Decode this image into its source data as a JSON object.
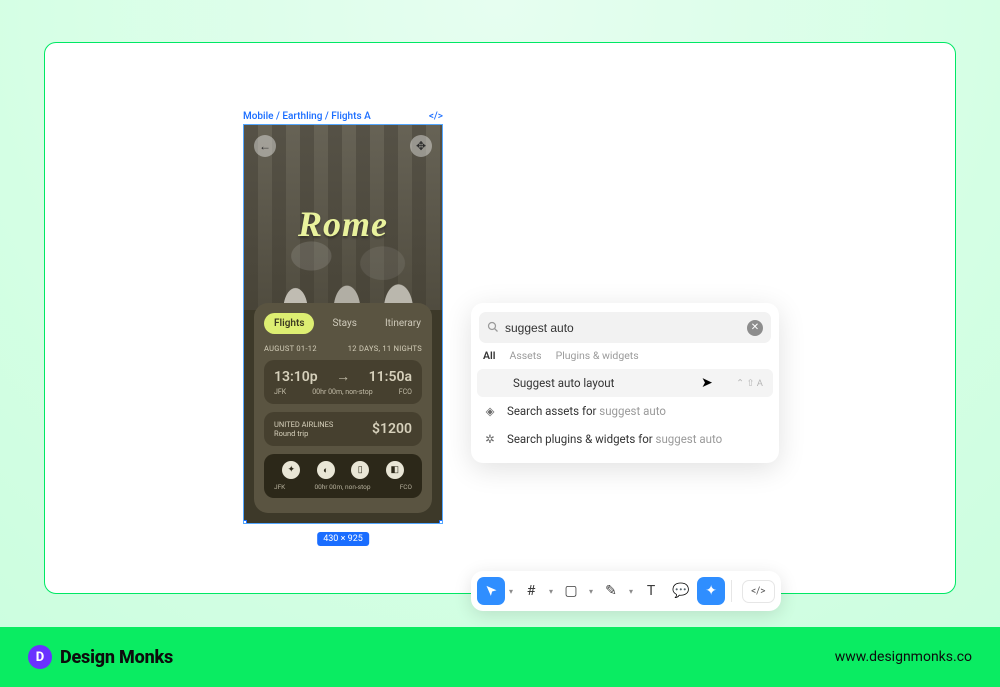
{
  "frame": {
    "path": "Mobile / Earthling / Flights A",
    "dimensions": "430 × 925"
  },
  "hero": {
    "destination": "Rome"
  },
  "tabs": [
    "Flights",
    "Stays",
    "Itinerary"
  ],
  "dates": {
    "range": "AUGUST 01-12",
    "duration": "12 DAYS, 11 NIGHTS"
  },
  "flight": {
    "depTime": "13:10p",
    "arrTime": "11:50a",
    "depCode": "JFK",
    "duration": "00hr 00m, non-stop",
    "arrCode": "FCO"
  },
  "price": {
    "airline": "UNITED AIRLINES",
    "trip": "Round trip",
    "amount": "$1200"
  },
  "bottom": {
    "depCode": "JFK",
    "duration": "00hr 00m, non-stop",
    "arrCode": "FCO"
  },
  "search": {
    "value": "suggest auto",
    "tabs": {
      "active": "All",
      "t2": "Assets",
      "t3": "Plugins & widgets"
    },
    "items": {
      "suggest": "Suggest auto layout",
      "assets_prefix": "Search assets for ",
      "assets_query": "suggest auto",
      "plugins_prefix": "Search plugins & widgets for ",
      "plugins_query": "suggest auto",
      "shortcut": "⌃ ⇧ A"
    }
  },
  "toolbar": {
    "code": "</>"
  },
  "footer": {
    "brand": "Design Monks",
    "url": "www.designmonks.co"
  }
}
